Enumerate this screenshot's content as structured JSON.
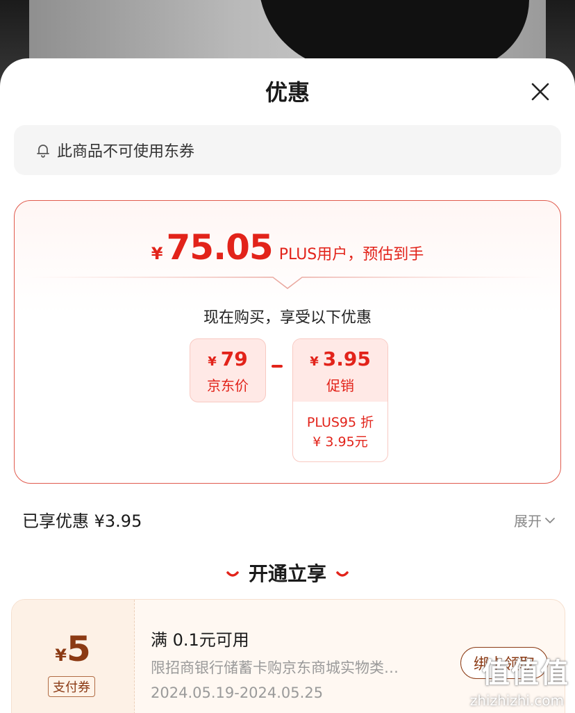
{
  "sheet": {
    "title": "优惠",
    "close_icon": "close-icon"
  },
  "notice": {
    "icon": "bell-icon",
    "text": "此商品不可使用东券"
  },
  "estimate": {
    "currency": "¥",
    "amount": "75.05",
    "label": "PLUS用户，预估到手"
  },
  "breakdown": {
    "heading": "现在购买，享受以下优惠",
    "jd_price": {
      "currency": "¥",
      "value": "79",
      "label": "京东价"
    },
    "promotion": {
      "currency": "¥",
      "value": "3.95",
      "label": "促销",
      "detail_line1": "PLUS95 折",
      "detail_line2": "¥ 3.95元"
    }
  },
  "enjoyed": {
    "text": "已享优惠 ¥3.95",
    "expand_label": "展开"
  },
  "section": {
    "title": "开通立享"
  },
  "coupon": {
    "currency": "¥",
    "amount": "5",
    "tag": "支付券",
    "condition": "满 0.1元可用",
    "description": "限招商银行储蓄卡购京东商城实物类…",
    "dates": "2024.05.19-2024.05.25",
    "button": "绑卡领取"
  },
  "watermark": {
    "text": "值值值",
    "url": "zhizhizhi.com"
  },
  "colors": {
    "accent": "#e2231a",
    "coupon_brown": "#8b3a14"
  }
}
